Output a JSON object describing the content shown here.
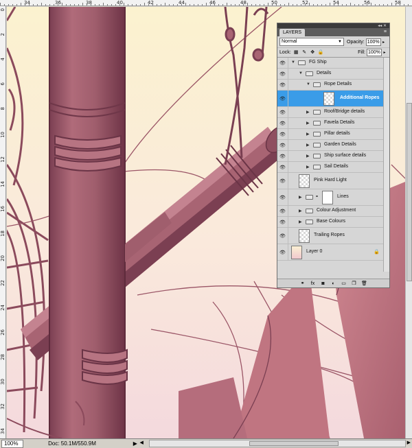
{
  "rulers": {
    "top_labels": [
      "34",
      "36",
      "38",
      "40",
      "42",
      "44",
      "46",
      "48",
      "50",
      "52",
      "54",
      "56",
      "58"
    ],
    "left_labels": [
      "0",
      "2",
      "4",
      "6",
      "8",
      "10",
      "12",
      "14",
      "16",
      "18",
      "20",
      "22",
      "24",
      "26",
      "28",
      "30",
      "32",
      "34"
    ]
  },
  "status": {
    "zoom": "100%",
    "doc": "Doc: 50.1M/550.9M",
    "arrow": "▶"
  },
  "panel": {
    "tab_label": "LAYERS",
    "menu_icon": "≡",
    "collapse_icon": "◂◂ ✕",
    "blend_mode": "Normal",
    "opacity_label": "Opacity:",
    "opacity_value": "100%",
    "lock_label": "Lock:",
    "fill_label": "Fill:",
    "fill_value": "100%"
  },
  "layers": [
    {
      "name": "FG Ship",
      "type": "group",
      "expanded": true,
      "indent": 0
    },
    {
      "name": "Details",
      "type": "group",
      "expanded": true,
      "indent": 1
    },
    {
      "name": "Rope Details",
      "type": "group",
      "expanded": true,
      "indent": 2
    },
    {
      "name": "Additional Ropes",
      "type": "layer",
      "selected": true,
      "indent": 3
    },
    {
      "name": "Roof/Bridge details",
      "type": "group",
      "expanded": false,
      "indent": 2
    },
    {
      "name": "Favela Details",
      "type": "group",
      "expanded": false,
      "indent": 2
    },
    {
      "name": "Pillar details",
      "type": "group",
      "expanded": false,
      "indent": 2
    },
    {
      "name": "Garden Details",
      "type": "group",
      "expanded": false,
      "indent": 2
    },
    {
      "name": "Ship surface details",
      "type": "group",
      "expanded": false,
      "indent": 2
    },
    {
      "name": "Sail Details",
      "type": "group",
      "expanded": false,
      "indent": 2
    },
    {
      "name": "Pink Hard Light",
      "type": "layer",
      "indent": 1
    },
    {
      "name": "Lines",
      "type": "masked-group",
      "expanded": false,
      "indent": 1
    },
    {
      "name": "Colour Adjustment",
      "type": "group",
      "expanded": false,
      "indent": 1
    },
    {
      "name": "Base Colours",
      "type": "group",
      "expanded": false,
      "indent": 1
    },
    {
      "name": "Trailing Ropes",
      "type": "layer",
      "indent": 1
    },
    {
      "name": "Layer 0",
      "type": "background",
      "locked": true,
      "indent": 0
    }
  ],
  "colors": {
    "canvas_bg": "#f7efcf",
    "pipe": "#a05e6d",
    "pipe_dark": "#7a3f52",
    "sail": "#c07581",
    "rope": "#8b4a5c",
    "selection": "#3a9ce8"
  },
  "icons": {
    "eye": "eye-icon",
    "folder": "folder-icon",
    "lock": "lock-icon",
    "link": "link-icon",
    "fx": "fx-icon",
    "mask": "mask-icon",
    "adjustment": "adjustment-icon",
    "new_group": "new-group-icon",
    "new_layer": "new-layer-icon",
    "trash": "trash-icon"
  }
}
